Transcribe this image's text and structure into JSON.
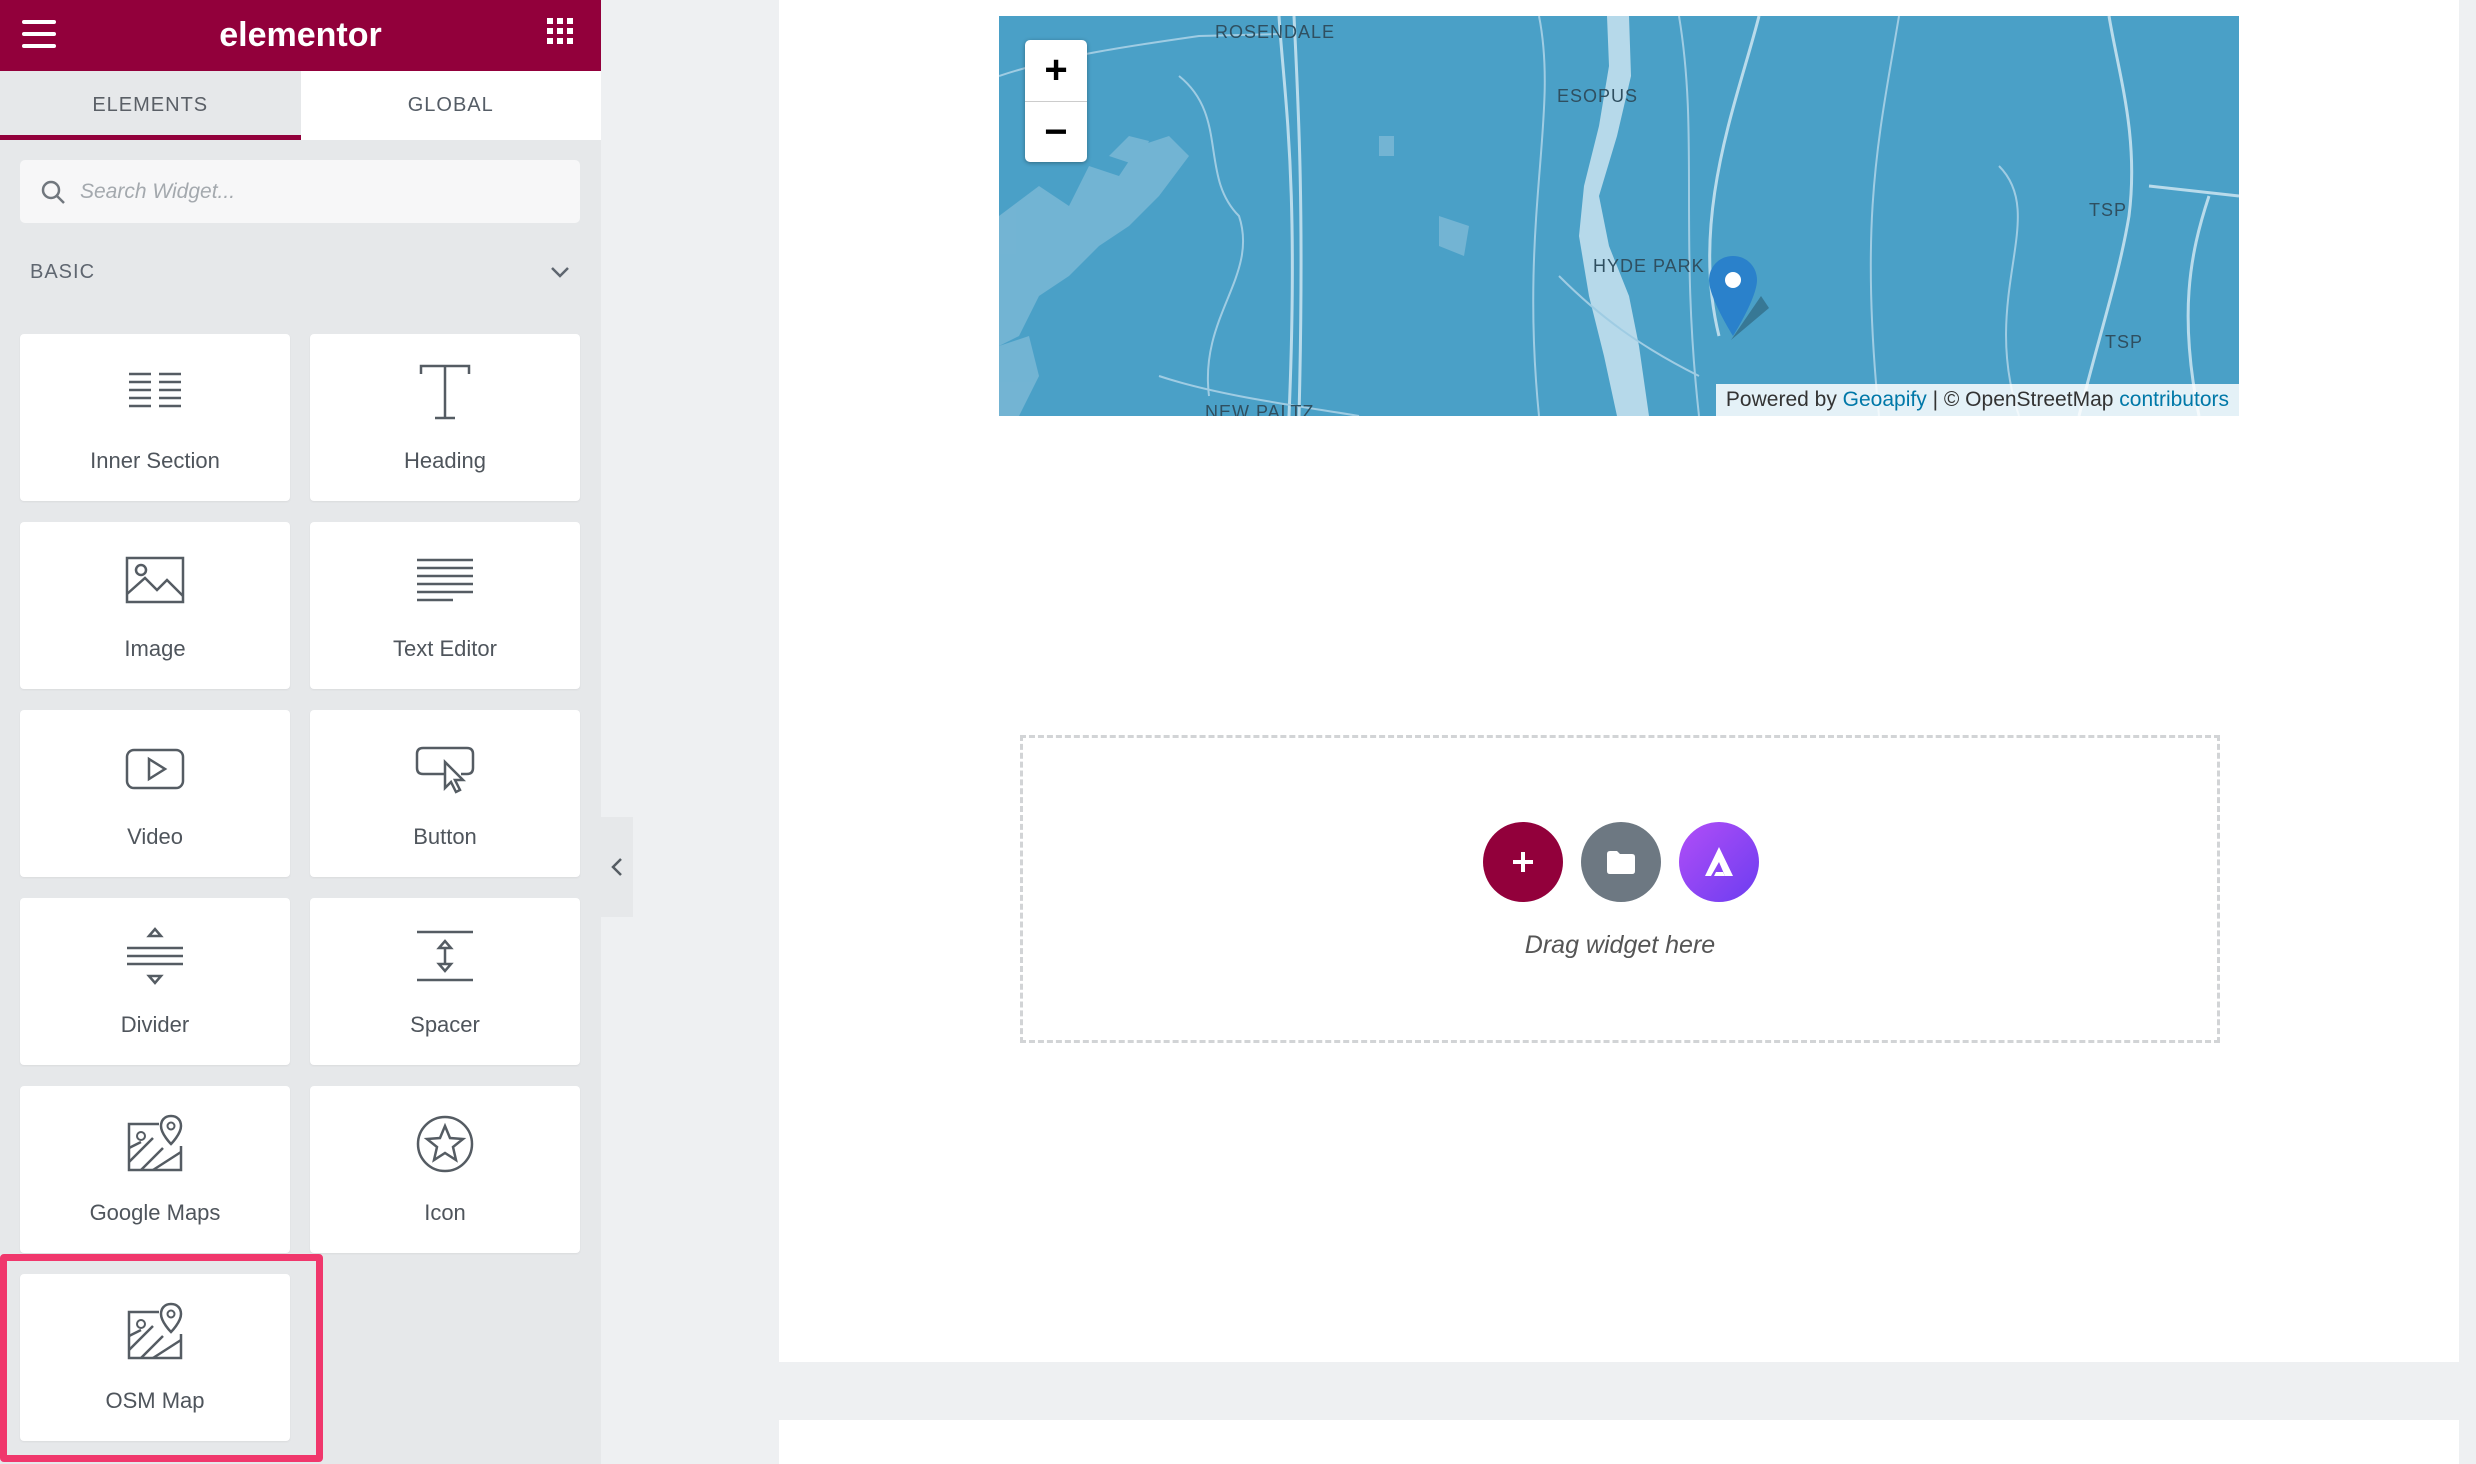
{
  "app": {
    "brand": "elementor"
  },
  "tabs": [
    {
      "label": "ELEMENTS"
    },
    {
      "label": "GLOBAL"
    }
  ],
  "search": {
    "placeholder": "Search Widget..."
  },
  "category": {
    "label": "BASIC"
  },
  "widgets": [
    {
      "label": "Inner Section",
      "icon": "inner-section-icon"
    },
    {
      "label": "Heading",
      "icon": "heading-icon"
    },
    {
      "label": "Image",
      "icon": "image-icon"
    },
    {
      "label": "Text Editor",
      "icon": "text-editor-icon"
    },
    {
      "label": "Video",
      "icon": "video-icon"
    },
    {
      "label": "Button",
      "icon": "button-icon"
    },
    {
      "label": "Divider",
      "icon": "divider-icon"
    },
    {
      "label": "Spacer",
      "icon": "spacer-icon"
    },
    {
      "label": "Google Maps",
      "icon": "google-maps-icon"
    },
    {
      "label": "Icon",
      "icon": "star-icon"
    },
    {
      "label": "OSM Map",
      "icon": "osm-map-icon"
    }
  ],
  "map": {
    "labels": [
      "ROSENDALE",
      "ESOPUS",
      "HYDE PARK",
      "TSP",
      "TSP",
      "NEW PALTZ"
    ],
    "attribution": {
      "prefix": "Powered by",
      "geoapify": "Geoapify",
      "separator": "| © OpenStreetMap",
      "contributors": "contributors"
    },
    "zoom_in": "+",
    "zoom_out": "−",
    "water_color": "#4aa0c7"
  },
  "dropzone": {
    "text": "Drag widget here"
  },
  "colors": {
    "brand": "#92003b",
    "highlight": "#f0376c",
    "fab_add": "#92003b",
    "fab_template": "#6d7882",
    "fab_astra": "#8a3ffc"
  }
}
